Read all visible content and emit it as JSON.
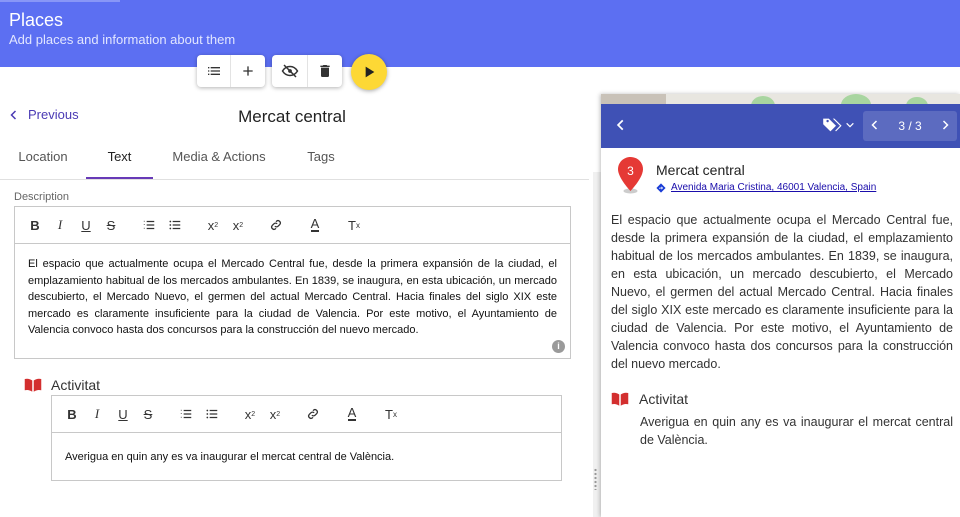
{
  "header": {
    "title": "Places",
    "subtitle": "Add places and information about them"
  },
  "toolbar": {
    "list_icon": "list-icon",
    "add_icon": "plus-icon",
    "hide_icon": "eye-off-icon",
    "delete_icon": "trash-icon",
    "play_icon": "play-icon"
  },
  "nav": {
    "previous_label": "Previous",
    "place_title": "Mercat central"
  },
  "tabs": [
    {
      "label": "Location"
    },
    {
      "label": "Text"
    },
    {
      "label": "Media & Actions"
    },
    {
      "label": "Tags"
    }
  ],
  "active_tab": "Text",
  "description": {
    "label": "Description",
    "text": "El espacio que actualmente ocupa el Mercado Central fue, desde la primera expansión de la ciudad, el emplazamiento habitual de los mercados ambulantes. En 1839, se inaugura, en esta ubicación, un mercado descubierto, el Mercado Nuevo, el germen del actual Mercado Central. Hacia finales del siglo XIX este mercado es claramente insuficiente para la ciudad de Valencia. Por este motivo, el Ayuntamiento de Valencia convoco hasta dos concursos para la construcción del nuevo mercado."
  },
  "activity": {
    "title": "Activitat",
    "text": "Averigua en quin any es va inaugurar el mercat central de València."
  },
  "preview": {
    "pager": "3 / 3",
    "marker_number": "3",
    "title": "Mercat central",
    "address": "Avenida Maria Cristina, 46001 Valencia, Spain",
    "text": "El espacio que actualmente ocupa el Mercado Central fue, desde la primera expansión de la ciudad, el emplazamiento habitual de los mercados ambulantes. En 1839, se inaugura, en esta ubicación, un mercado descubierto, el Mercado Nuevo, el germen del actual Mercado Central. Hacia finales del siglo XIX este mercado es claramente insuficiente para la ciudad de Valencia. Por este motivo, el Ayuntamiento de Valencia convoco hasta dos concursos para la construcción del nuevo mercado.",
    "activity_title": "Activitat",
    "activity_text": "Averigua en quin any es va inaugurar el mercat central de València."
  },
  "colors": {
    "header": "#5c6ff2",
    "panel_bar": "#3f51b5",
    "play_button": "#fdd835",
    "tab_indicator": "#673ab7",
    "marker": "#e53935"
  }
}
